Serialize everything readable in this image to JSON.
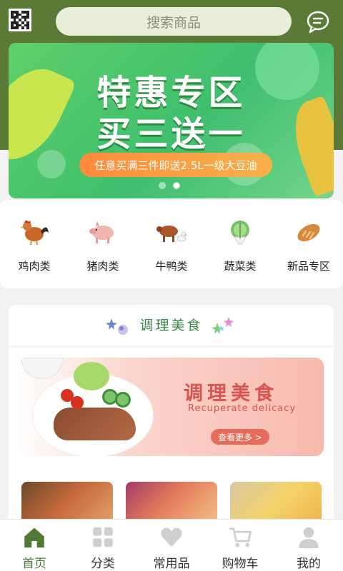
{
  "header": {
    "search_placeholder": "搜索商品",
    "qr_icon": "qr-code-icon",
    "message_icon": "chat-bubble-icon"
  },
  "banner": {
    "title_line1": "特惠专区",
    "title_line2": "买三送一",
    "subtitle": "任意买满三件即送2.5L一级大豆油",
    "active_dot": 2,
    "dot_count": 2
  },
  "categories": [
    {
      "label": "鸡肉类",
      "icon": "rooster-icon"
    },
    {
      "label": "猪肉类",
      "icon": "pig-icon"
    },
    {
      "label": "牛鸭类",
      "icon": "cow-duck-icon"
    },
    {
      "label": "蔬菜类",
      "icon": "cabbage-icon"
    },
    {
      "label": "新品专区",
      "icon": "bread-icon"
    }
  ],
  "section": {
    "title": "调理美食",
    "promo_title": "调理美食",
    "promo_subtitle": "Recuperate delicacy",
    "promo_button": "查看更多 >"
  },
  "tabbar": {
    "items": [
      {
        "label": "首页",
        "icon": "home-icon",
        "active": true
      },
      {
        "label": "分类",
        "icon": "grid-icon",
        "active": false
      },
      {
        "label": "常用品",
        "icon": "heart-icon",
        "active": false
      },
      {
        "label": "购物车",
        "icon": "cart-icon",
        "active": false
      },
      {
        "label": "我的",
        "icon": "person-icon",
        "active": false
      }
    ]
  },
  "colors": {
    "brand_green": "#5b7a35",
    "active_tab": "#4e7a33",
    "section_title": "#3b8a49",
    "promo_red": "#d9534f"
  }
}
